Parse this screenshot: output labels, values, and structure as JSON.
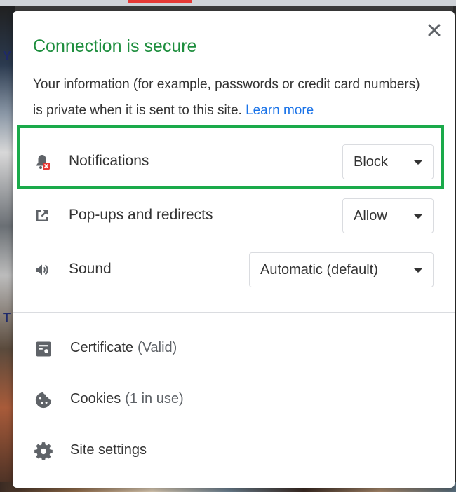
{
  "popup": {
    "title": "Connection is secure",
    "description": "Your information (for example, passwords or credit card numbers) is private when it is sent to this site.",
    "learn_more": "Learn more",
    "close_symbol": "✕"
  },
  "permissions": [
    {
      "label": "Notifications",
      "value": "Block",
      "icon": "notifications-blocked-icon"
    },
    {
      "label": "Pop-ups and redirects",
      "value": "Allow",
      "icon": "external-link-icon"
    },
    {
      "label": "Sound",
      "value": "Automatic (default)",
      "icon": "speaker-icon"
    }
  ],
  "links": [
    {
      "label": "Certificate",
      "sub": "(Valid)",
      "icon": "certificate-icon"
    },
    {
      "label": "Cookies",
      "sub": "(1 in use)",
      "icon": "cookie-icon"
    },
    {
      "label": "Site settings",
      "sub": "",
      "icon": "gear-icon"
    }
  ],
  "colors": {
    "title_green": "#1e8e3e",
    "link_blue": "#1a73e8",
    "highlight_green": "#1aaa4a",
    "blocked_red": "#e53935"
  }
}
